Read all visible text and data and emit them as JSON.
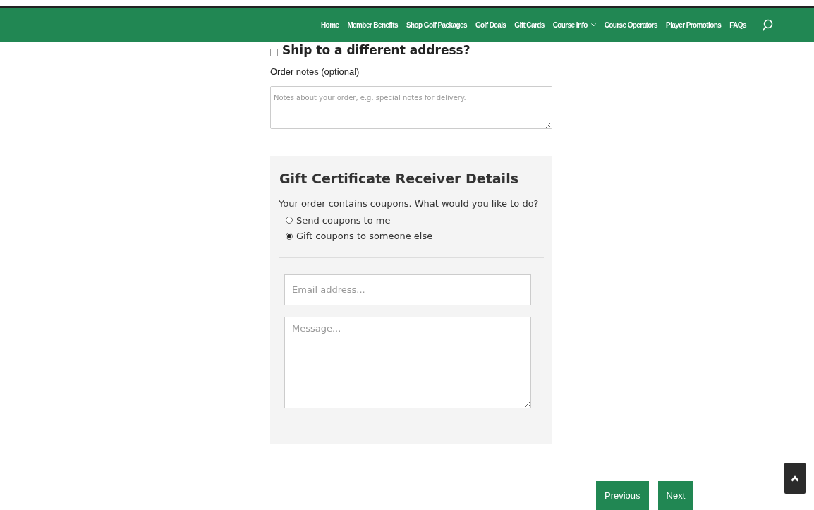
{
  "nav": {
    "items": [
      {
        "label": "Home",
        "dropdown": false
      },
      {
        "label": "Member Benefits",
        "dropdown": false
      },
      {
        "label": "Shop Golf Packages",
        "dropdown": false
      },
      {
        "label": "Golf Deals",
        "dropdown": false
      },
      {
        "label": "Gift Cards",
        "dropdown": false
      },
      {
        "label": "Course Info",
        "dropdown": true
      },
      {
        "label": "Course Operators",
        "dropdown": false
      },
      {
        "label": "Player Promotions",
        "dropdown": false
      },
      {
        "label": "FAQs",
        "dropdown": false
      }
    ]
  },
  "ship_different": {
    "label": "Ship to a different address?",
    "checked": false
  },
  "order_notes": {
    "label": "Order notes (optional)",
    "placeholder": "Notes about your order, e.g. special notes for delivery."
  },
  "gift": {
    "title": "Gift Certificate Receiver Details",
    "question": "Your order contains coupons. What would you like to do?",
    "options": [
      {
        "label": "Send coupons to me",
        "selected": false
      },
      {
        "label": "Gift coupons to someone else",
        "selected": true
      }
    ],
    "email": {
      "placeholder": "Email address..."
    },
    "message": {
      "placeholder": "Message..."
    }
  },
  "buttons": [
    "Previous",
    "Next"
  ]
}
